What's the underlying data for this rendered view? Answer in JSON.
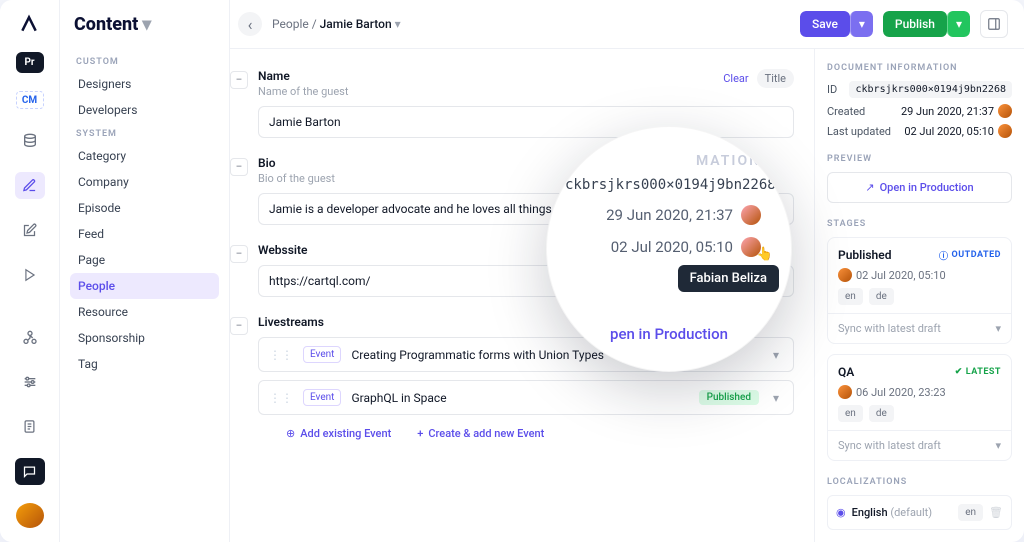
{
  "sidebar": {
    "title": "Content",
    "groups": [
      {
        "label": "CUSTOM",
        "items": [
          "Designers",
          "Developers"
        ]
      },
      {
        "label": "SYSTEM",
        "items": [
          "Category",
          "Company",
          "Episode",
          "Feed",
          "Page",
          "People",
          "Resource",
          "Sponsorship",
          "Tag"
        ],
        "active": "People"
      }
    ]
  },
  "breadcrumb": {
    "root": "People",
    "current": "Jamie Barton"
  },
  "topbar": {
    "save": "Save",
    "publish": "Publish"
  },
  "fields": {
    "name": {
      "label": "Name",
      "sub": "Name of the guest",
      "clear": "Clear",
      "badge": "Title",
      "value": "Jamie Barton"
    },
    "bio": {
      "label": "Bio",
      "sub": "Bio of the guest",
      "value": "Jamie is a developer advocate and he loves all things Jav"
    },
    "website": {
      "label": "Webssite",
      "value": "https://cartql.com/"
    },
    "livestreams": {
      "label": "Livestreams",
      "tag": "Event",
      "items": [
        {
          "title": "Creating Programmatic forms with Union Types",
          "status": ""
        },
        {
          "title": "GraphQL in Space",
          "status": "Published"
        }
      ],
      "add_existing": "Add existing Event",
      "create_new": "Create & add new Event"
    }
  },
  "meta": {
    "info_h": "DOCUMENT INFORMATION",
    "id_label": "ID",
    "id_value": "ckbrsjkrs000×0194j9bn2268",
    "created_label": "Created",
    "created_value": "29 Jun 2020, 21:37",
    "updated_label": "Last updated",
    "updated_value": "02 Jul 2020, 05:10",
    "preview_h": "PREVIEW",
    "open_prod": "Open in Production",
    "stages_h": "STAGES",
    "stages": [
      {
        "name": "Published",
        "flag": "OUTDATED",
        "flag_type": "warn",
        "date": "02 Jul 2020, 05:10",
        "locales": [
          "en",
          "de"
        ],
        "sync": "Sync with latest draft"
      },
      {
        "name": "QA",
        "flag": "LATEST",
        "flag_type": "latest",
        "date": "06 Jul 2020, 23:23",
        "locales": [
          "en",
          "de"
        ],
        "sync": "Sync with latest draft"
      }
    ],
    "loc_h": "LOCALIZATIONS",
    "loc_name": "English",
    "loc_default": "(default)",
    "loc_code": "en"
  },
  "magnifier": {
    "h": "MATION",
    "id": "ckbrsjkrs000×0194j9bn2268",
    "date1": "29 Jun 2020, 21:37",
    "date2": "02 Jul 2020, 05:10",
    "tooltip": "Fabian Beliza",
    "link": "pen in Production"
  }
}
